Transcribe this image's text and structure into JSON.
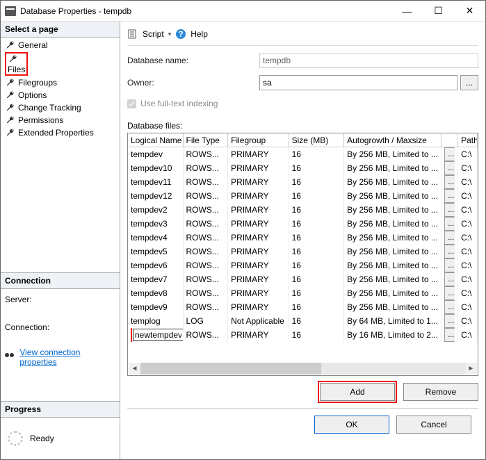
{
  "title": "Database Properties - tempdb",
  "window": {
    "min": "—",
    "max": "☐",
    "close": "✕"
  },
  "sidebar": {
    "hdr_pages": "Select a page",
    "items": [
      {
        "label": "General"
      },
      {
        "label": "Files"
      },
      {
        "label": "Filegroups"
      },
      {
        "label": "Options"
      },
      {
        "label": "Change Tracking"
      },
      {
        "label": "Permissions"
      },
      {
        "label": "Extended Properties"
      }
    ],
    "hdr_conn": "Connection",
    "server_lbl": "Server:",
    "conn_lbl": "Connection:",
    "view_conn": "View connection properties",
    "hdr_prog": "Progress",
    "ready": "Ready"
  },
  "toolbar": {
    "script": "Script",
    "help": "Help",
    "drop": "▾"
  },
  "form": {
    "dbname_lbl": "Database name:",
    "dbname_val": "tempdb",
    "owner_lbl": "Owner:",
    "owner_val": "sa",
    "dots": "...",
    "fulltext": "Use full-text indexing",
    "dbfiles_lbl": "Database files:"
  },
  "table": {
    "headers": [
      "Logical Name",
      "File Type",
      "Filegroup",
      "Size (MB)",
      "Autogrowth / Maxsize",
      "",
      "Path"
    ],
    "rows": [
      {
        "name": "tempdev",
        "type": "ROWS...",
        "fg": "PRIMARY",
        "size": "16",
        "ag": "By 256 MB, Limited to ...",
        "path": "C:\\"
      },
      {
        "name": "tempdev10",
        "type": "ROWS...",
        "fg": "PRIMARY",
        "size": "16",
        "ag": "By 256 MB, Limited to ...",
        "path": "C:\\"
      },
      {
        "name": "tempdev11",
        "type": "ROWS...",
        "fg": "PRIMARY",
        "size": "16",
        "ag": "By 256 MB, Limited to ...",
        "path": "C:\\"
      },
      {
        "name": "tempdev12",
        "type": "ROWS...",
        "fg": "PRIMARY",
        "size": "16",
        "ag": "By 256 MB, Limited to ...",
        "path": "C:\\"
      },
      {
        "name": "tempdev2",
        "type": "ROWS...",
        "fg": "PRIMARY",
        "size": "16",
        "ag": "By 256 MB, Limited to ...",
        "path": "C:\\"
      },
      {
        "name": "tempdev3",
        "type": "ROWS...",
        "fg": "PRIMARY",
        "size": "16",
        "ag": "By 256 MB, Limited to ...",
        "path": "C:\\"
      },
      {
        "name": "tempdev4",
        "type": "ROWS...",
        "fg": "PRIMARY",
        "size": "16",
        "ag": "By 256 MB, Limited to ...",
        "path": "C:\\"
      },
      {
        "name": "tempdev5",
        "type": "ROWS...",
        "fg": "PRIMARY",
        "size": "16",
        "ag": "By 256 MB, Limited to ...",
        "path": "C:\\"
      },
      {
        "name": "tempdev6",
        "type": "ROWS...",
        "fg": "PRIMARY",
        "size": "16",
        "ag": "By 256 MB, Limited to ...",
        "path": "C:\\"
      },
      {
        "name": "tempdev7",
        "type": "ROWS...",
        "fg": "PRIMARY",
        "size": "16",
        "ag": "By 256 MB, Limited to ...",
        "path": "C:\\"
      },
      {
        "name": "tempdev8",
        "type": "ROWS...",
        "fg": "PRIMARY",
        "size": "16",
        "ag": "By 256 MB, Limited to ...",
        "path": "C:\\"
      },
      {
        "name": "tempdev9",
        "type": "ROWS...",
        "fg": "PRIMARY",
        "size": "16",
        "ag": "By 256 MB, Limited to ...",
        "path": "C:\\"
      },
      {
        "name": "templog",
        "type": "LOG",
        "fg": "Not Applicable",
        "size": "16",
        "ag": "By 64 MB, Limited to 1...",
        "path": "C:\\"
      },
      {
        "name": "newtempdev",
        "type": "ROWS...",
        "fg": "PRIMARY",
        "size": "16",
        "ag": "By 16 MB, Limited to 2...",
        "path": "C:\\",
        "editing": true
      }
    ]
  },
  "buttons": {
    "add": "Add",
    "remove": "Remove",
    "ok": "OK",
    "cancel": "Cancel"
  }
}
